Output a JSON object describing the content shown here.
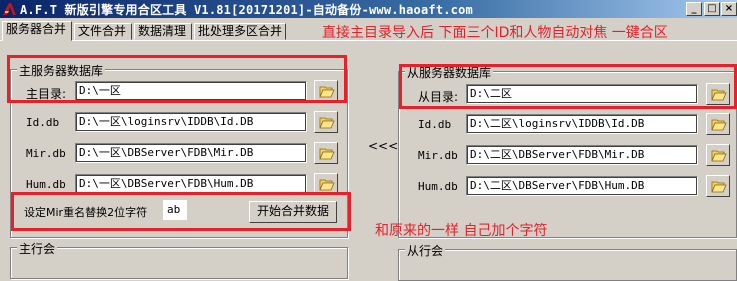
{
  "window": {
    "title": "A.F.T 新版引擎专用合区工具 V1.81[20171201]-自动备份-www.haoaft.com"
  },
  "tabs": [
    {
      "label": "服务器合并"
    },
    {
      "label": "文件合并"
    },
    {
      "label": "数据清理"
    },
    {
      "label": "批处理多区合并"
    }
  ],
  "annotations": {
    "top": "直接主目录导入后 下面三个ID和人物自动对焦 一键合区",
    "bottom": "和原来的一样 自己加个字符"
  },
  "master": {
    "group_label": "主服务器数据库",
    "dir_label": "主目录:",
    "dir_value": "D:\\一区",
    "id_label": "Id.db",
    "id_value": "D:\\一区\\loginsrv\\IDDB\\Id.DB",
    "mir_label": "Mir.db",
    "mir_value": "D:\\一区\\DBServer\\FDB\\Mir.DB",
    "hum_label": "Hum.db",
    "hum_value": "D:\\一区\\DBServer\\FDB\\Hum.DB",
    "rename_label": "设定Mir重名替换2位字符",
    "rename_value": "ab",
    "start_button": "开始合并数据"
  },
  "arrow": "<<<",
  "slave": {
    "group_label": "从服务器数据库",
    "dir_label": "从目录:",
    "dir_value": "D:\\二区",
    "id_label": "Id.db",
    "id_value": "D:\\二区\\loginsrv\\IDDB\\Id.DB",
    "mir_label": "Mir.db",
    "mir_value": "D:\\二区\\DBServer\\FDB\\Mir.DB",
    "hum_label": "Hum.db",
    "hum_value": "D:\\二区\\DBServer\\FDB\\Hum.DB"
  },
  "bottom_groups": {
    "master_row": "主行会",
    "slave_row": "从行会"
  },
  "colors": {
    "annotation": "#e8202a",
    "titlebar_start": "#0a246a",
    "titlebar_end": "#a6caf0"
  },
  "icons": {
    "app": "app-icon",
    "folder": "open-folder-icon"
  }
}
